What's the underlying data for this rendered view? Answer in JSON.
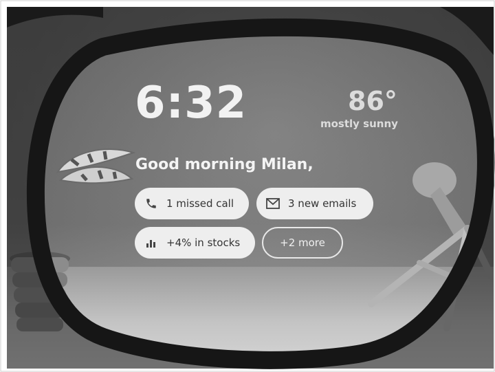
{
  "clock": {
    "time": "6:32"
  },
  "weather": {
    "temperature": "86°",
    "condition": "mostly sunny"
  },
  "greeting": "Good morning Milan,",
  "notifications": [
    {
      "label": "1 missed call",
      "icon": "phone-icon"
    },
    {
      "label": "3 new emails",
      "icon": "mail-icon"
    },
    {
      "label": "+4% in stocks",
      "icon": "bar-chart-icon"
    },
    {
      "label": "+2 more"
    }
  ],
  "colors": {
    "chip_bg": "#eeeeee",
    "chip_text": "#333333",
    "overlay_text": "#f2f2f2",
    "lens_frame": "#141414"
  }
}
